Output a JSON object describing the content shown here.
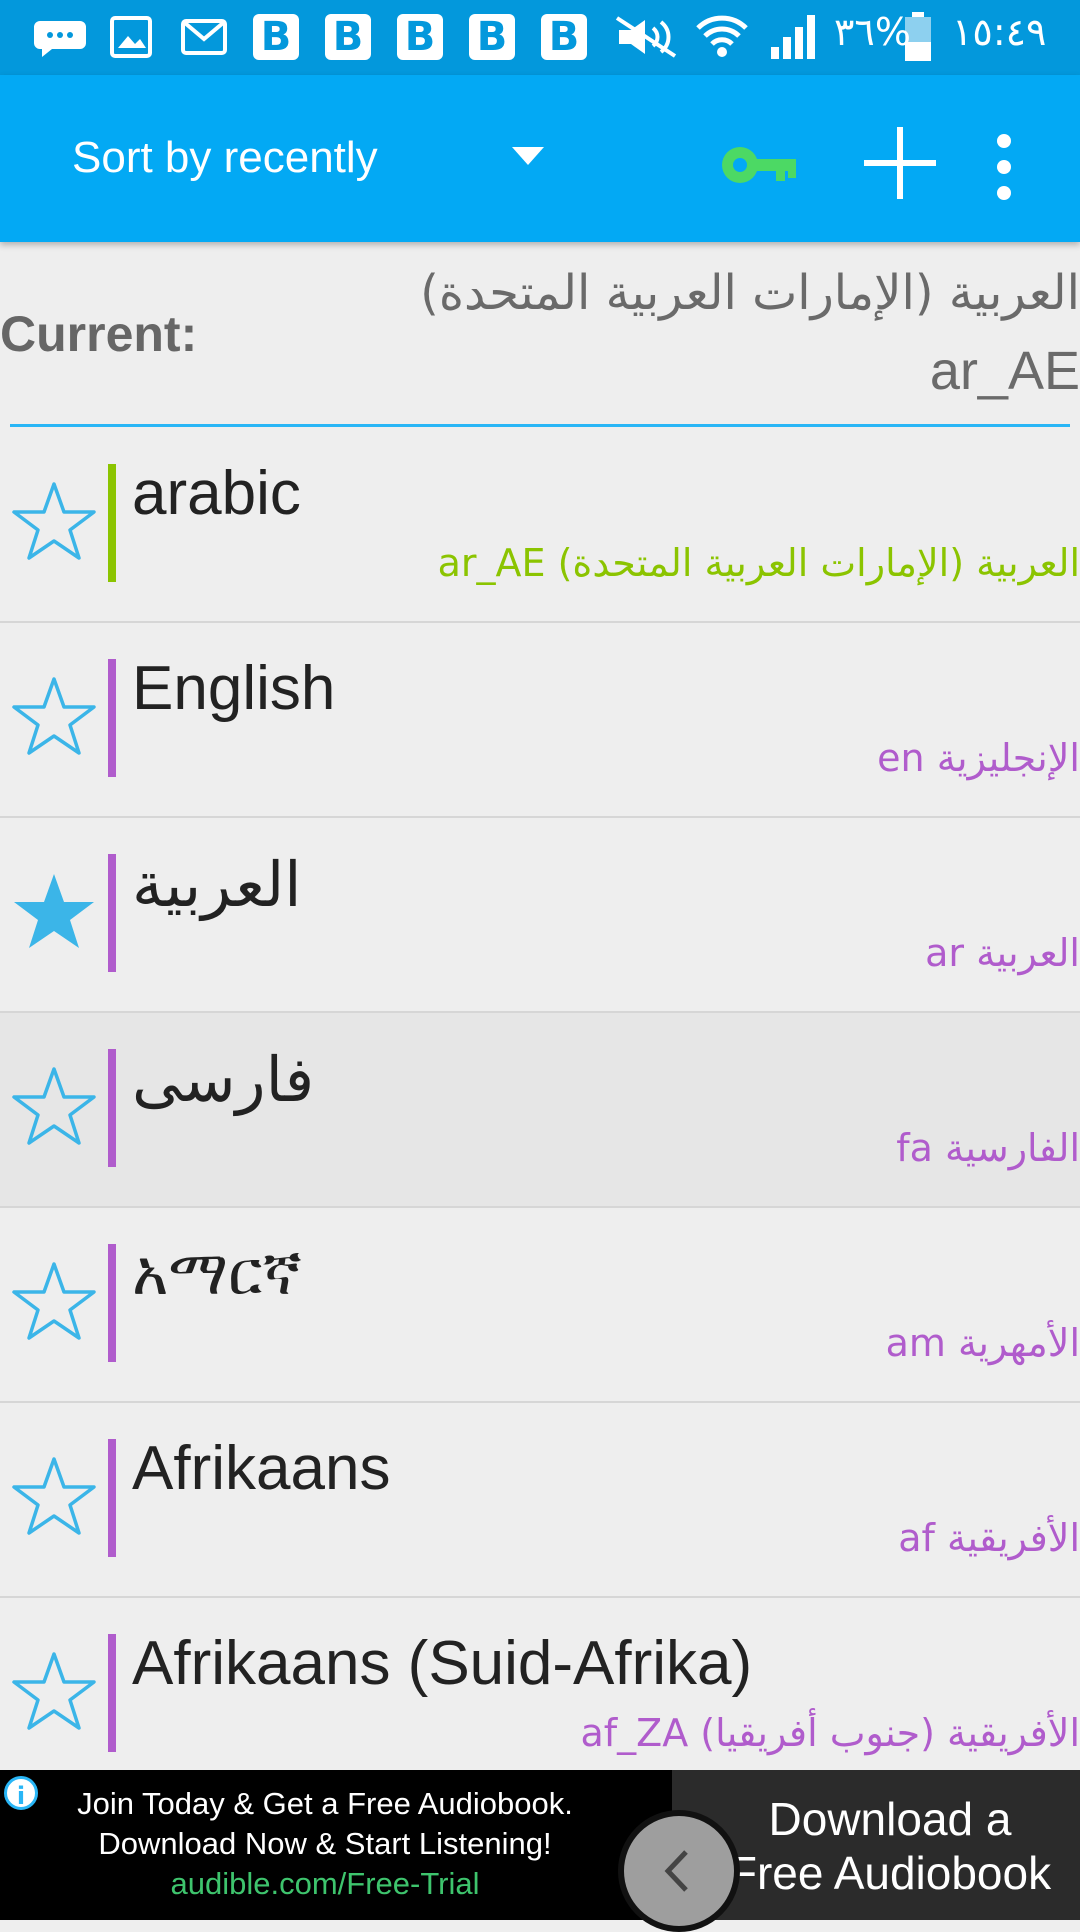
{
  "status_bar": {
    "battery": "٣٦%",
    "time": "١٥:٤٩",
    "notification_b": "B"
  },
  "toolbar": {
    "sort_label": "Sort by recently",
    "key_color": "#4cd964"
  },
  "current": {
    "label": "Current:",
    "name": "العربية (الإمارات العربية المتحدة)",
    "code": "ar_AE"
  },
  "languages": [
    {
      "name": "arabic",
      "sub": "ar_AE العربية (الإمارات العربية المتحدة)",
      "color": "#8bc400",
      "starred": false
    },
    {
      "name": "English",
      "sub": "en الإنجليزية",
      "color": "#b05ccc",
      "starred": false
    },
    {
      "name": "العربية",
      "sub": "ar العربية",
      "color": "#b05ccc",
      "starred": true
    },
    {
      "name": "فارسی",
      "sub": "fa الفارسية",
      "color": "#b05ccc",
      "starred": false
    },
    {
      "name": "አማርኛ",
      "sub": "am الأمهرية",
      "color": "#b05ccc",
      "starred": false
    },
    {
      "name": "Afrikaans",
      "sub": "af الأفريقية",
      "color": "#b05ccc",
      "starred": false
    },
    {
      "name": "Afrikaans (Suid-Afrika)",
      "sub": "af_ZA الأفريقية (جنوب أفريقيا)",
      "color": "#b05ccc",
      "starred": false
    }
  ],
  "ad": {
    "line1": "Join Today & Get a Free Audiobook.",
    "line2": "Download Now & Start Listening!",
    "url": "audible.com/Free-Trial",
    "right_line1": "Download a",
    "right_line2": "Free Audiobook",
    "info_glyph": "i"
  },
  "colors": {
    "status_bar": "#0398dc",
    "toolbar": "#03a9f4",
    "star": "#3bb5e8",
    "divider": "#29b6f6"
  }
}
